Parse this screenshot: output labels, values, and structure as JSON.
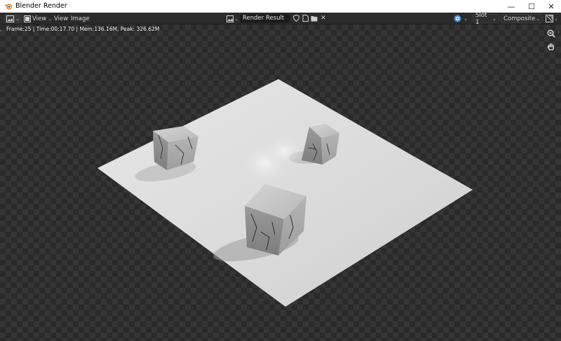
{
  "window": {
    "title": "Blender Render",
    "minimize_glyph": "—",
    "maximize_glyph": "☐",
    "close_glyph": "✕"
  },
  "header": {
    "editor_type_icon": "image-editor-icon",
    "view_dropdown_label": "View",
    "menu": [
      "View",
      "Image"
    ],
    "image_name": "Render Result",
    "slot_label": "Slot 1",
    "pass_label": "Composite"
  },
  "viewport": {
    "stats_text": "Frame:25 | Time:00:17.70 | Mem:136.16M, Peak: 326.62M",
    "tools": [
      "zoom-icon",
      "hand-pan-icon"
    ]
  },
  "colors": {
    "header_bg": "#2b2b2b",
    "checker_dark": "#2a2a2a",
    "checker_light": "#353535",
    "accent_blue": "#4a8fd8"
  }
}
